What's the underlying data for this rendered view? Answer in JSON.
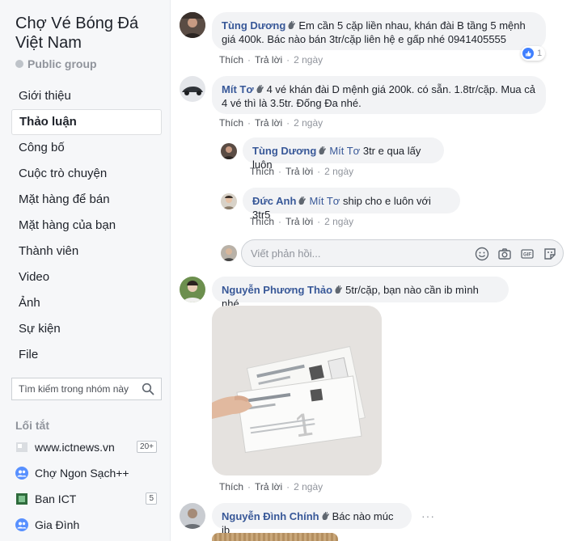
{
  "sidebar": {
    "group_title": "Chợ Vé Bóng Đá Việt Nam",
    "group_type": "Public group",
    "nav": [
      "Giới thiệu",
      "Thảo luận",
      "Công bố",
      "Cuộc trò chuyện",
      "Mặt hàng để bán",
      "Mặt hàng của bạn",
      "Thành viên",
      "Video",
      "Ảnh",
      "Sự kiện",
      "File"
    ],
    "search_placeholder": "Tìm kiếm trong nhóm này",
    "shortcuts_title": "Lối tắt",
    "shortcuts": [
      {
        "label": "www.ictnews.vn",
        "badge": "20+"
      },
      {
        "label": "Chợ Ngon Sạch++",
        "badge": ""
      },
      {
        "label": "Ban ICT",
        "badge": "5"
      },
      {
        "label": "Gia Đình",
        "badge": ""
      }
    ]
  },
  "action_labels": {
    "like": "Thích",
    "reply": "Trả lời"
  },
  "comments": [
    {
      "name": "Tùng Dương",
      "text": "Em cần 5 cặp liền nhau, khán đài B tầng 5 mệnh giá 400k. Bác nào bán 3tr/cặp liên hệ e gấp nhé 0941405555",
      "time": "2 ngày",
      "reaction_count": "1"
    },
    {
      "name": "Mít Tơ",
      "text": "4 vé khán đài D mệnh giá 200k. có sẵn. 1.8tr/cặp. Mua cả 4 vé thì là 3.5tr. Đống Đa nhé.",
      "time": "2 ngày"
    },
    {
      "name": "Tùng Dương",
      "tag": "Mít Tơ",
      "text": "3tr e qua lấy luôn",
      "time": "2 ngày"
    },
    {
      "name": "Đức Anh",
      "tag": "Mít Tơ",
      "text": "ship cho e luôn với 3tr5",
      "time": "2 ngày"
    },
    {
      "name": "Nguyễn Phương Thảo",
      "text": "5tr/cặp, bạn nào cần ib mình nhé.",
      "time": "2 ngày"
    },
    {
      "name": "Nguyễn Đình Chính",
      "text": "Bác nào múc ib"
    }
  ],
  "reply_placeholder": "Viết phản hồi...",
  "colors": {
    "link": "#385898",
    "bubble": "#f2f3f5",
    "sidebar_bg": "#f6f7f9",
    "like_blue": "#4080ff"
  }
}
